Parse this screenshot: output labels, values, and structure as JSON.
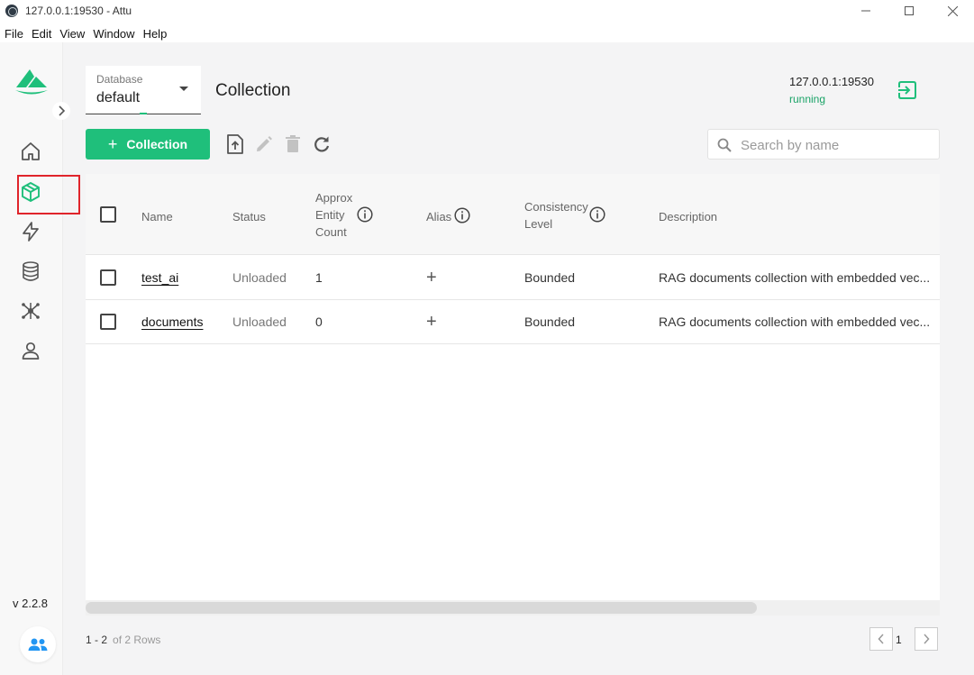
{
  "window": {
    "title": "127.0.0.1:19530 - Attu",
    "menu": [
      "File",
      "Edit",
      "View",
      "Window",
      "Help"
    ]
  },
  "sidebar": {
    "items": [
      {
        "name": "home",
        "icon": "home-icon"
      },
      {
        "name": "collections",
        "icon": "cube-icon",
        "active": true
      },
      {
        "name": "search",
        "icon": "lightning-icon"
      },
      {
        "name": "databases",
        "icon": "database-icon"
      },
      {
        "name": "system",
        "icon": "network-icon"
      },
      {
        "name": "users",
        "icon": "user-icon"
      }
    ],
    "version": "v 2.2.8"
  },
  "header": {
    "database_label": "Database",
    "database_value": "default",
    "page_title": "Collection",
    "server_address": "127.0.0.1:19530",
    "server_status": "running"
  },
  "toolbar": {
    "add_label": "Collection",
    "search_placeholder": "Search by name"
  },
  "table": {
    "columns": {
      "name": "Name",
      "status": "Status",
      "approx_entity_count": [
        "Approx",
        "Entity",
        "Count"
      ],
      "alias": "Alias",
      "consistency_level": [
        "Consistency",
        "Level"
      ],
      "description": "Description"
    },
    "rows": [
      {
        "name": "test_ai",
        "status": "Unloaded",
        "count": "1",
        "consistency": "Bounded",
        "description": "RAG documents collection with embedded vec..."
      },
      {
        "name": "documents",
        "status": "Unloaded",
        "count": "0",
        "consistency": "Bounded",
        "description": "RAG documents collection with embedded vec..."
      }
    ]
  },
  "pagination": {
    "range": "1 - 2",
    "total": "of 2 Rows",
    "page": "1"
  },
  "colors": {
    "accent": "#1fbf7b",
    "status_running": "#1aa367",
    "highlight_box": "#e0242b"
  }
}
